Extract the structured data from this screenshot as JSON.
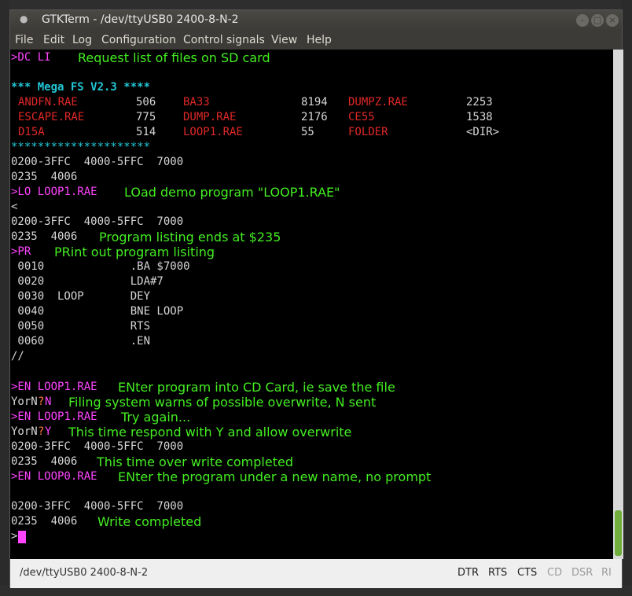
{
  "window": {
    "title": "GTKTerm - /dev/ttyUSB0  2400-8-N-2"
  },
  "menu": [
    "File",
    "Edit",
    "Log",
    "Configuration",
    "Control signals",
    "View",
    "Help"
  ],
  "terminal": {
    "l1_cmd": ">DC LI",
    "l1_comment": "Request list of files on SD card",
    "l2_header": "*** Mega FS V2.3 ****",
    "files_row1": {
      "n1": "ANDFN.RAE",
      "s1": "506",
      "n2": "BA33",
      "s2": "8194",
      "n3": "DUMPZ.RAE",
      "s3": "2253"
    },
    "files_row2": {
      "n1": "ESCAPE.RAE",
      "s1": "775",
      "n2": "DUMP.RAE",
      "s2": "2176",
      "n3": "CE55",
      "s3": "1538"
    },
    "files_row3": {
      "n1": "D15A",
      "s1": "514",
      "n2": "LOOP1.RAE",
      "s2": "55",
      "n3": "FOLDER",
      "s3": "<DIR>"
    },
    "stars": "*********************",
    "mem1": "0200-3FFC  4000-5FFC  7000",
    "mem2": "0235  4006",
    "lo_cmd": ">LO LOOP1.RAE",
    "lo_comment": "LOad demo program \"LOOP1.RAE\"",
    "lt": "<",
    "mem3": "0200-3FFC  4000-5FFC  7000",
    "mem4": "0235  4006",
    "mem4_comment": "Program listing ends at $235",
    "pr_cmd": ">PR",
    "pr_comment": "PRint out program lisiting",
    "prog": [
      " 0010             .BA $7000",
      " 0020             LDA#7",
      " 0030  LOOP       DEY",
      " 0040             BNE LOOP",
      " 0050             RTS",
      " 0060             .EN"
    ],
    "slashes": "//",
    "en1_cmd": ">EN LOOP1.RAE",
    "en1_comment": "ENter program into CD Card, ie save the file",
    "yorn1_a": "YorN",
    "yorn1_q": "?",
    "yorn1_b": "N",
    "yorn1_comment": "Filing system warns of possible overwrite, N sent",
    "en2_cmd": ">EN LOOP1.RAE",
    "en2_comment": "Try again...",
    "yorn2_a": "YorN",
    "yorn2_q": "?",
    "yorn2_b": "Y",
    "yorn2_comment": "This time respond with Y and allow overwrite",
    "mem5": "0200-3FFC  4000-5FFC  7000",
    "mem6": "0235  4006",
    "mem6_comment": "This time over write completed",
    "en3_cmd": ">EN LOOP0.RAE",
    "en3_comment": "ENter the program under a new name, no prompt",
    "mem7": "0200-3FFC  4000-5FFC  7000",
    "mem8": "0235  4006",
    "mem8_comment": "Write completed",
    "prompt": ">"
  },
  "status": {
    "port": "/dev/ttyUSB0  2400-8-N-2",
    "signals": [
      "DTR",
      "RTS",
      "CTS",
      "CD",
      "DSR",
      "RI"
    ]
  },
  "colors": {
    "prompt": "#ff44ff",
    "comment": "#44ee22",
    "header": "#22c8d6",
    "files": "#e02828",
    "scroll_thumb": "#6fae3c"
  }
}
